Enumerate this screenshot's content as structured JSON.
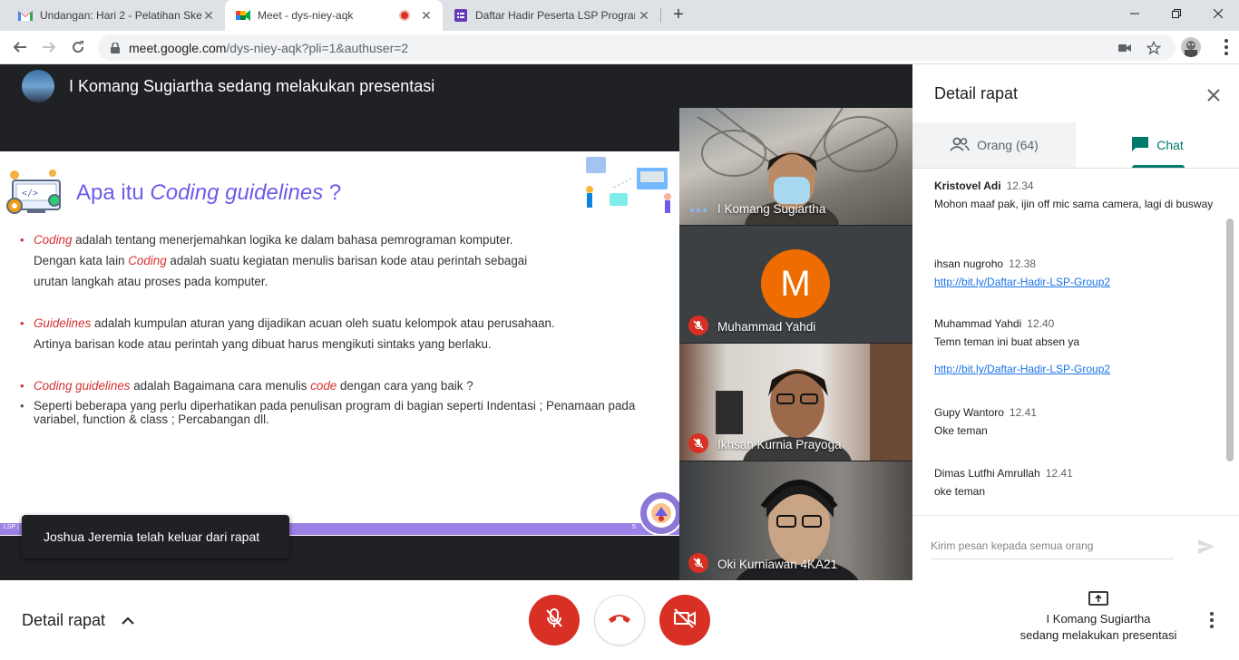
{
  "browser": {
    "tabs": [
      {
        "title": "Undangan: Hari 2 - Pelatihan Ske",
        "icon": "gmail-icon",
        "active": false
      },
      {
        "title": "Meet - dys-niey-aqk",
        "icon": "meet-icon",
        "active": true
      },
      {
        "title": "Daftar Hadir Peserta LSP Program",
        "icon": "forms-icon",
        "active": false
      }
    ],
    "new_tab": "+",
    "url_host": "meet.google.com",
    "url_path": "/dys-niey-aqk?pli=1&authuser=2"
  },
  "stage": {
    "presenter_text": "I Komang Sugiartha sedang melakukan presentasi",
    "slide": {
      "title_prefix": "Apa itu ",
      "title_italic": "Coding guidelines",
      "title_suffix": " ?",
      "b1_red": "Coding",
      "b1_rest": " adalah tentang menerjemahkan logika ke dalam bahasa pemrograman komputer.",
      "b1_line2_a": "Dengan kata lain ",
      "b1_line2_red": "Coding",
      "b1_line2_b": " adalah  suatu kegiatan menulis barisan kode atau perintah sebagai",
      "b1_line3": "urutan langkah atau proses pada komputer.",
      "b2_red": "Guidelines",
      "b2_rest": " adalah kumpulan aturan yang dijadikan acuan oleh suatu kelompok atau perusahaan.",
      "b2_line2": "Artinya barisan kode atau perintah yang dibuat harus mengikuti sintaks yang berlaku.",
      "b3_red": "Coding guidelines",
      "b3_mid": " adalah  Bagaimana cara menulis ",
      "b3_red2": "code",
      "b3_end": " dengan cara yang baik ?",
      "b4": "Seperti beberapa yang perlu diperhatikan pada penulisan program di bagian seperti  Indentasi ; Penamaan pada variabel, function & class ; Percabangan dll.",
      "footer_left": "LSP |",
      "footer_page": "5"
    },
    "participants": [
      {
        "name": "I Komang Sugiartha",
        "muted": false
      },
      {
        "name": "Muhammad Yahdi",
        "muted": true,
        "initial": "M"
      },
      {
        "name": "Ikhsan Kurnia Prayoga",
        "muted": true
      },
      {
        "name": "Oki Kurniawan 4KA21",
        "muted": true
      }
    ],
    "toast": "Joshua Jeremia telah keluar dari rapat"
  },
  "panel": {
    "title": "Detail rapat",
    "tab_people": "Orang (64)",
    "tab_chat": "Chat",
    "messages": [
      {
        "sender": "Kristovel Adi",
        "time": "12.34",
        "text": "Mohon maaf pak, ijin off mic sama camera, lagi di busway"
      },
      {
        "sender": "ihsan nugroho",
        "time": "12.38",
        "link": "http://bit.ly/Daftar-Hadir-LSP-Group2"
      },
      {
        "sender": "Muhammad Yahdi",
        "time": "12.40",
        "text": "Temn teman ini buat absen ya",
        "link": "http://bit.ly/Daftar-Hadir-LSP-Group2"
      },
      {
        "sender": "Gupy Wantoro",
        "time": "12.41",
        "text": "Oke teman"
      },
      {
        "sender": "Dimas Lutfhi Amrullah",
        "time": "12.41",
        "text": "oke teman"
      }
    ],
    "compose_placeholder": "Kirim pesan kepada semua orang"
  },
  "bottom": {
    "details_label": "Detail rapat",
    "presenting_line1": "I Komang Sugiartha",
    "presenting_line2": "sedang melakukan presentasi"
  },
  "colors": {
    "accent_purple": "#6c5ce7",
    "red_text": "#d63031",
    "mute_red": "#d93025",
    "chat_teal": "#00796b",
    "avatar_orange": "#ef6c00",
    "link_blue": "#1a73e8"
  }
}
